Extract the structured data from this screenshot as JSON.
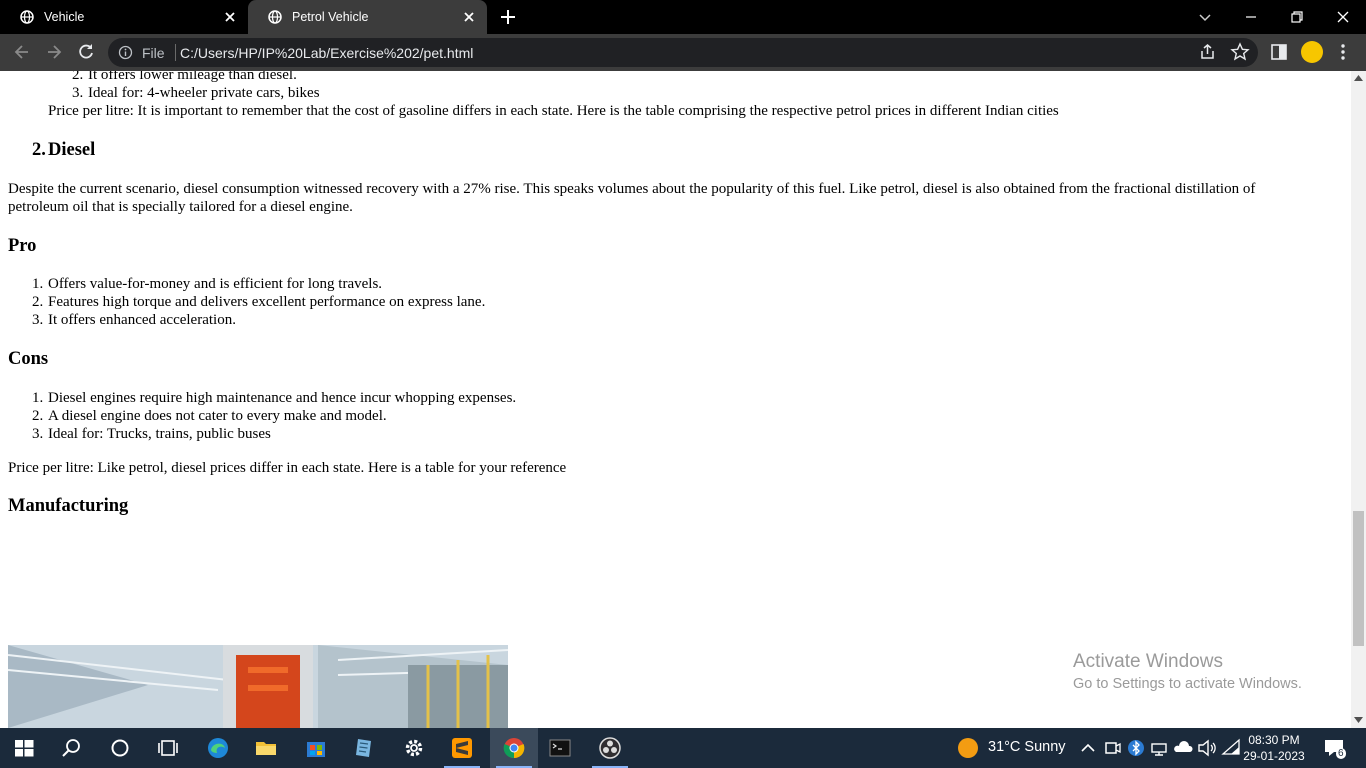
{
  "browser": {
    "tabs": [
      {
        "title": "Vehicle",
        "active": false
      },
      {
        "title": "Petrol Vehicle",
        "active": true
      }
    ],
    "scheme_label": "File",
    "url": "C:/Users/HP/IP%20Lab/Exercise%202/pet.html"
  },
  "page": {
    "petrol_cons_tail": [
      {
        "num": "2.",
        "text": "It offers lower mileage than diesel."
      },
      {
        "num": "3.",
        "text": "Ideal for: 4-wheeler private cars, bikes"
      }
    ],
    "petrol_price": "Price per litre: It is important to remember that the cost of gasoline differs in each state. Here is the table comprising the respective petrol prices in different Indian cities",
    "diesel_num": "2.",
    "diesel_heading": "Diesel",
    "diesel_para_line1": "Despite the current scenario, diesel consumption witnessed recovery with a 27% rise. This speaks volumes about the popularity of this fuel. Like petrol, diesel is also obtained from the fractional distillation of",
    "diesel_para_line2": "petroleum oil that is specially tailored for a diesel engine.",
    "pro_heading": "Pro",
    "pros": [
      {
        "num": "1.",
        "text": "Offers value-for-money and is efficient for long travels."
      },
      {
        "num": "2.",
        "text": "Features high torque and delivers excellent performance on express lane."
      },
      {
        "num": "3.",
        "text": "It offers enhanced acceleration."
      }
    ],
    "cons_heading": "Cons",
    "cons": [
      {
        "num": "1.",
        "text": "Diesel engines require high maintenance and hence incur whopping expenses."
      },
      {
        "num": "2.",
        "text": "A diesel engine does not cater to every make and model."
      },
      {
        "num": "3.",
        "text": "Ideal for: Trucks, trains, public buses"
      }
    ],
    "diesel_price": "Price per litre: Like petrol, diesel prices differ in each state. Here is a table for your reference",
    "manufacturing_heading": "Manufacturing"
  },
  "watermark": {
    "line1": "Activate Windows",
    "line2": "Go to Settings to activate Windows."
  },
  "taskbar": {
    "weather": "31°C  Sunny",
    "time": "08:30 PM",
    "date": "29-01-2023",
    "notification_count": "6"
  },
  "icons": [
    "globe-icon",
    "close-icon",
    "plus-icon",
    "back-icon",
    "forward-icon",
    "reload-icon",
    "info-icon",
    "share-icon",
    "star-icon",
    "sidepanel-icon",
    "kebab-menu-icon",
    "windows-start-icon",
    "search-icon",
    "cortana-icon",
    "task-view-icon",
    "edge-icon",
    "file-explorer-icon",
    "store-icon",
    "settings-icon",
    "sublime-icon",
    "chrome-icon",
    "terminal-icon",
    "obs-icon"
  ],
  "colors": {
    "tabstrip": "#000000",
    "toolbar": "#3c3c3c",
    "taskbar": "#1b2a3b",
    "profile": "#f7c600"
  }
}
